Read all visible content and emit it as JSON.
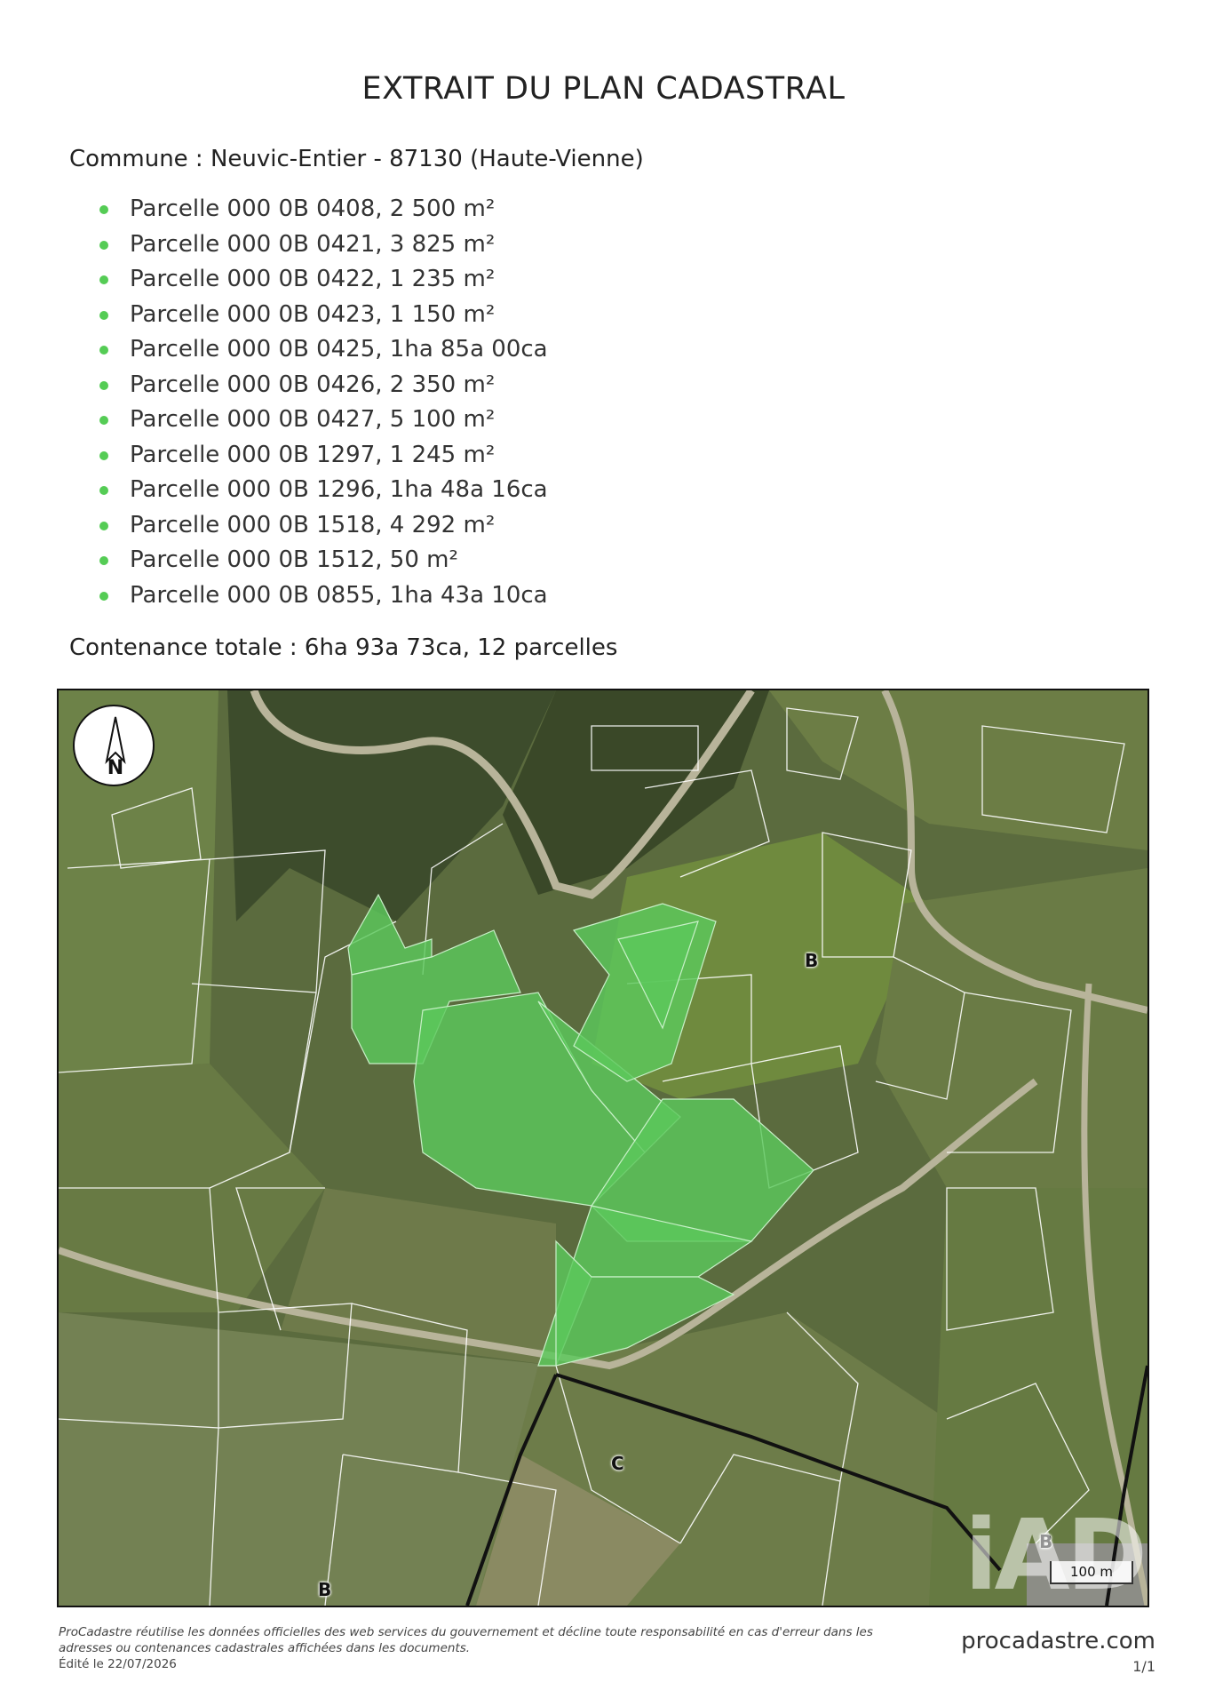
{
  "title": "EXTRAIT DU PLAN CADASTRAL",
  "commune": "Commune : Neuvic-Entier - 87130 (Haute-Vienne)",
  "parcels": [
    "Parcelle 000 0B 0408, 2 500 m²",
    "Parcelle 000 0B 0421, 3 825 m²",
    "Parcelle 000 0B 0422, 1 235 m²",
    "Parcelle 000 0B 0423, 1 150 m²",
    "Parcelle 000 0B 0425, 1ha 85a 00ca",
    "Parcelle 000 0B 0426, 2 350 m²",
    "Parcelle 000 0B 0427, 5 100 m²",
    "Parcelle 000 0B 1297, 1 245 m²",
    "Parcelle 000 0B 1296, 1ha 48a 16ca",
    "Parcelle 000 0B 1518, 4 292 m²",
    "Parcelle 000 0B 1512, 50 m²",
    "Parcelle 000 0B 0855, 1ha 43a 10ca"
  ],
  "total": "Contenance totale : 6ha 93a 73ca, 12 parcelles",
  "map": {
    "north_label": "N",
    "section_labels": [
      "B",
      "C",
      "B",
      "B"
    ],
    "scale_label": "100 m",
    "watermark": "iAD",
    "highlight_color": "#5cc85c",
    "imagery_color": "#56663a"
  },
  "footer": {
    "disclaimer": "ProCadastre réutilise les données officielles des web services du gouvernement et décline toute responsabilité en cas d'erreur dans les adresses ou contenances cadastrales affichées dans les documents.",
    "edit_date": "Édité le 22/07/2026",
    "site": "procadastre.com",
    "page": "1/1"
  }
}
